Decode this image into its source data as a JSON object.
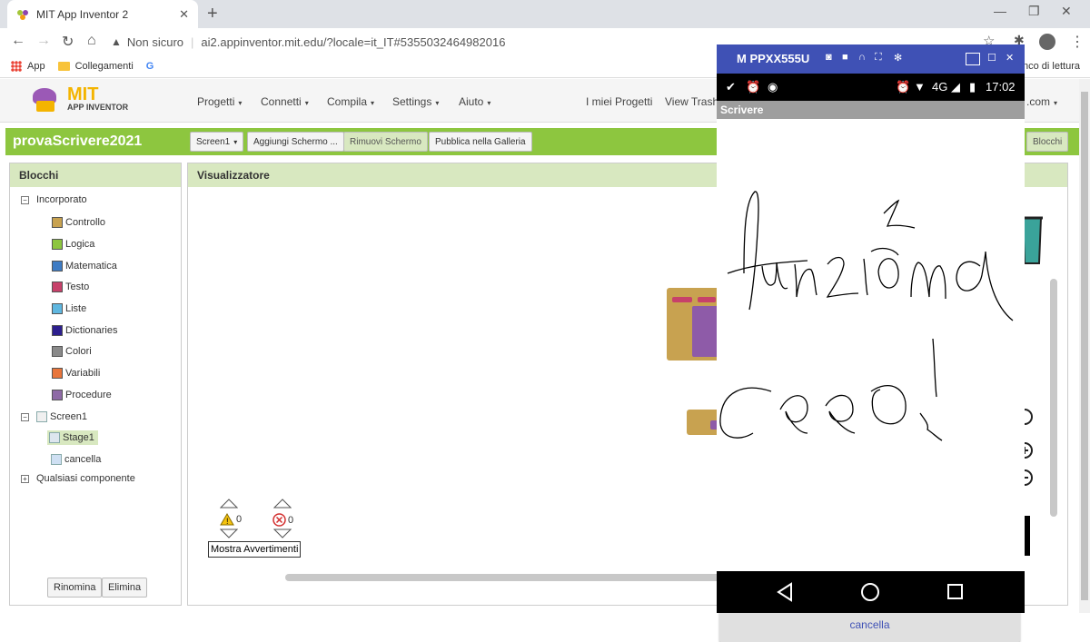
{
  "browser": {
    "tab_title": "MIT App Inventor 2",
    "address_security": "Non sicuro",
    "url": "ai2.appinventor.mit.edu/?locale=it_IT#5355032464982016",
    "bookmarks": [
      "App",
      "Collegamenti"
    ],
    "bookmarks_right": "nco di lettura"
  },
  "header": {
    "logo_title": "MIT",
    "logo_subtitle": "APP INVENTOR",
    "menus": [
      "Progetti",
      "Connetti",
      "Compila",
      "Settings",
      "Aiuto"
    ],
    "my_projects": "I miei Progetti",
    "view_trash": "View Trash",
    "account_suffix": ".com"
  },
  "project": {
    "name": "provaScrivere2021",
    "screen_select": "Screen1",
    "add_screen": "Aggiungi Schermo ...",
    "remove_screen": "Rimuovi Schermo",
    "publish": "Pubblica nella Galleria",
    "blocks_button": "Blocchi"
  },
  "blocks_panel": {
    "title": "Blocchi",
    "builtin_label": "Incorporato",
    "builtin": [
      {
        "label": "Controllo",
        "color": "#c8a250"
      },
      {
        "label": "Logica",
        "color": "#8dc63f"
      },
      {
        "label": "Matematica",
        "color": "#3e7cc4"
      },
      {
        "label": "Testo",
        "color": "#c7416a"
      },
      {
        "label": "Liste",
        "color": "#5fb7e0"
      },
      {
        "label": "Dictionaries",
        "color": "#2d1f8e"
      },
      {
        "label": "Colori",
        "color": "#8a8a8a"
      },
      {
        "label": "Variabili",
        "color": "#e8753b"
      },
      {
        "label": "Procedure",
        "color": "#8e6aa6"
      }
    ],
    "screen": "Screen1",
    "components": [
      "Stage1",
      "cancella"
    ],
    "any_component": "Qualsiasi componente",
    "rename_button": "Rinomina",
    "delete_button": "Elimina"
  },
  "viewer": {
    "title": "Visualizzatore",
    "warnings_count": "0",
    "errors_count": "0",
    "show_warnings": "Mostra Avvertimenti"
  },
  "emulator": {
    "device_name": "M PPXX555U",
    "network": "4G",
    "time": "17:02",
    "app_title": "Scrivere",
    "handwriting_lines": [
      "funziona",
      "ciao!"
    ],
    "button_label": "cancella"
  }
}
